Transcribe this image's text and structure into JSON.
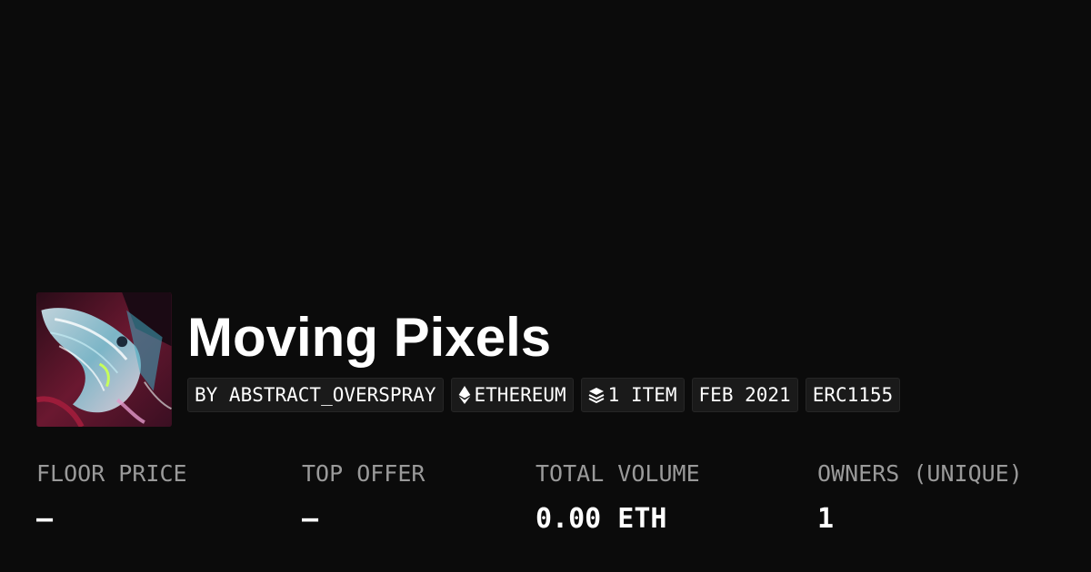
{
  "collection": {
    "title": "Moving Pixels",
    "thumbnail_icon": "collection-artwork"
  },
  "tags": {
    "creator": "BY ABSTRACT_OVERSPRAY",
    "chain": "ETHEREUM",
    "chain_icon": "ethereum-icon",
    "items": "1 ITEM",
    "items_icon": "layers-icon",
    "date": "FEB 2021",
    "standard": "ERC1155"
  },
  "stats": {
    "floor_price": {
      "label": "FLOOR PRICE",
      "value": "—"
    },
    "top_offer": {
      "label": "TOP OFFER",
      "value": "—"
    },
    "total_volume": {
      "label": "TOTAL VOLUME",
      "value": "0.00 ETH"
    },
    "owners": {
      "label": "OWNERS (UNIQUE)",
      "value": "1"
    }
  },
  "colors": {
    "background": "#0b0b0b",
    "tag_background": "#1a1a1a",
    "label_gray": "#9a9a9a",
    "text": "#ffffff"
  }
}
